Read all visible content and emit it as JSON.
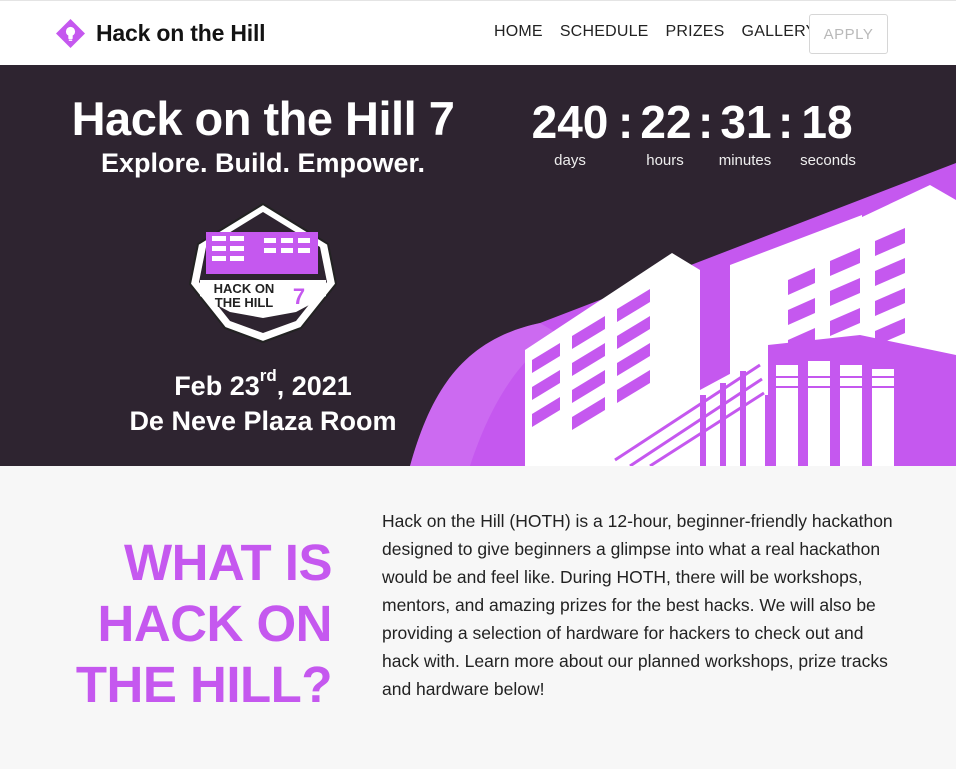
{
  "nav": {
    "brand": "Hack on the Hill",
    "items": [
      "HOME",
      "SCHEDULE",
      "PRIZES",
      "GALLERY"
    ],
    "apply_label": "APPLY"
  },
  "hero": {
    "title": "Hack on the Hill 7",
    "tagline": "Explore. Build. Empower.",
    "badge_line1": "HACK ON",
    "badge_line2": "THE HILL",
    "badge_number": "7",
    "date_main": "Feb 23",
    "date_suffix": "rd",
    "date_year": ", 2021",
    "venue": "De Neve Plaza Room"
  },
  "countdown": {
    "days": "240",
    "hours": "22",
    "minutes": "31",
    "seconds": "18",
    "separator": ":",
    "days_label": "days",
    "hours_label": "hours",
    "minutes_label": "minutes",
    "seconds_label": "seconds"
  },
  "about": {
    "heading_line1": "WHAT IS",
    "heading_line2": "HACK ON",
    "heading_line3": "THE HILL?",
    "body": "Hack on the Hill (HOTH) is a 12-hour, beginner-friendly hackathon designed to give beginners a glimpse into what a real hackathon would be and feel like. During HOTH, there will be workshops, mentors, and amazing prizes for the best hacks. We will also be providing a selection of hardware for hackers to check out and hack with. Learn more about our planned workshops, prize tracks and hardware below!"
  },
  "colors": {
    "accent": "#c558ef",
    "accent_light": "#d98cf5",
    "hero_bg": "#2e2430",
    "page_bg": "#f7f7f7"
  }
}
